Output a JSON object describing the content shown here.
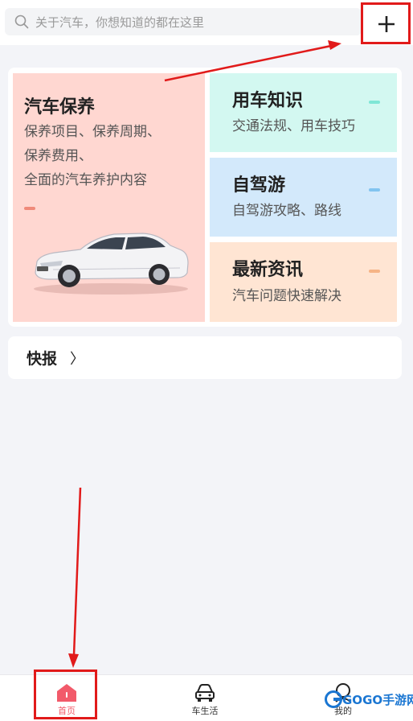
{
  "search": {
    "placeholder": "关于汽车，你想知道的都在这里"
  },
  "cards": {
    "main": {
      "title": "汽车保养",
      "lines": [
        "保养项目、保养周期、",
        "保养费用、",
        "全面的汽车养护内容"
      ]
    },
    "knowledge": {
      "title": "用车知识",
      "subtitle": "交通法规、用车技巧"
    },
    "travel": {
      "title": "自驾游",
      "subtitle": "自驾游攻略、路线"
    },
    "news": {
      "title": "最新资讯",
      "subtitle": "汽车问题快速解决"
    }
  },
  "quicknews": {
    "label": "快报",
    "chevron": "〉"
  },
  "tabbar": {
    "items": [
      {
        "label": "首页",
        "icon": "home-icon",
        "active": true
      },
      {
        "label": "车生活",
        "icon": "car-icon",
        "active": false
      },
      {
        "label": "我的",
        "icon": "profile-icon",
        "active": false
      }
    ]
  },
  "watermark": {
    "text": "GOGO手游网"
  },
  "colors": {
    "accent": "#f25a6a",
    "annotation": "#e11a1a",
    "main_tile": "#ffd7d1",
    "knowledge_tile": "#d3f8f1",
    "travel_tile": "#d3e9fb",
    "news_tile": "#ffe5d3"
  }
}
